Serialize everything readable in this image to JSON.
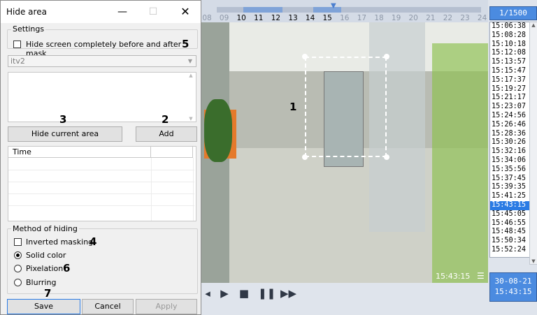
{
  "dialog": {
    "title": "Hide area",
    "settings_legend": "Settings",
    "hide_before_after_label": "Hide screen completely before and after mask",
    "camera_select_value": "itv2",
    "hide_current_area_label": "Hide current area",
    "add_label": "Add",
    "table_headers": [
      "Time",
      ""
    ],
    "method_legend": "Method of hiding",
    "inverted_masking_label": "Inverted masking",
    "solid_color_label": "Solid color",
    "pixelation_label": "Pixelation",
    "blurring_label": "Blurring",
    "save_label": "Save",
    "cancel_label": "Cancel",
    "apply_label": "Apply",
    "selected_method": "solid_color"
  },
  "callouts": {
    "n1": "1",
    "n2": "2",
    "n3": "3",
    "n4": "4",
    "n5": "5",
    "n6": "6",
    "n7": "7"
  },
  "timeline": {
    "ticks": [
      "08",
      "09",
      "10",
      "11",
      "12",
      "13",
      "14",
      "15",
      "16",
      "17",
      "18",
      "19",
      "20",
      "21",
      "22",
      "23",
      "24"
    ],
    "counter": "1/1500"
  },
  "video": {
    "timestamp": "15:43:15"
  },
  "events": {
    "times": [
      "15:06:38",
      "15:08:28",
      "15:10:18",
      "15:12:08",
      "15:13:57",
      "15:15:47",
      "15:17:37",
      "15:19:27",
      "15:21:17",
      "15:23:07",
      "15:24:56",
      "15:26:46",
      "15:28:36",
      "15:30:26",
      "15:32:16",
      "15:34:06",
      "15:35:56",
      "15:37:45",
      "15:39:35",
      "15:41:25",
      "15:43:15",
      "15:45:05",
      "15:46:55",
      "15:48:45",
      "15:50:34",
      "15:52:24"
    ],
    "selected": "15:43:15"
  },
  "datebox": {
    "date": "30-08-21",
    "time": "15:43:15"
  },
  "colors": {
    "accent": "#2a7be4",
    "mask_border": "#ffffff"
  }
}
